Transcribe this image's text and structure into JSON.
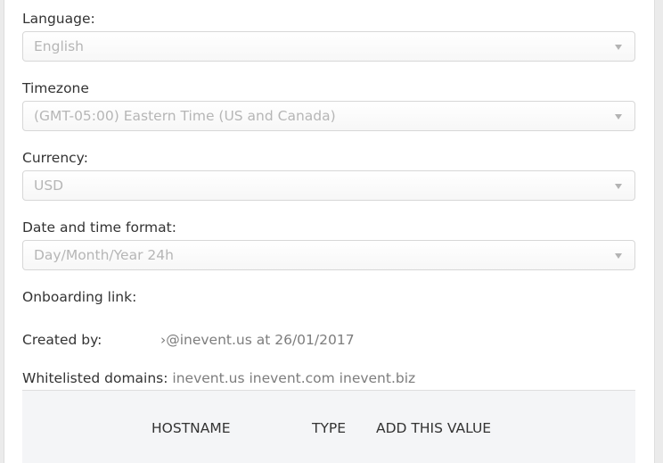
{
  "form": {
    "language": {
      "label": "Language:",
      "value": "English"
    },
    "timezone": {
      "label": "Timezone",
      "value": "(GMT-05:00) Eastern Time (US and Canada)"
    },
    "currency": {
      "label": "Currency:",
      "value": "USD"
    },
    "date_format": {
      "label": "Date and time format:",
      "value": "Day/Month/Year 24h"
    },
    "onboarding": {
      "label": "Onboarding link:"
    },
    "created_by": {
      "label": "Created by:",
      "value": "›@inevent.us at 26/01/2017"
    },
    "whitelisted": {
      "label": "Whitelisted domains:",
      "value": "inevent.us inevent.com inevent.biz"
    }
  },
  "dns_table": {
    "columns": [
      "HOSTNAME",
      "TYPE",
      "ADD THIS VALUE"
    ]
  },
  "icons": {
    "dropdown": "caret-down-icon"
  },
  "colors": {
    "placeholder_text": "#b6b6b6",
    "label_text": "#333333",
    "table_bg": "#f4f5f7"
  }
}
